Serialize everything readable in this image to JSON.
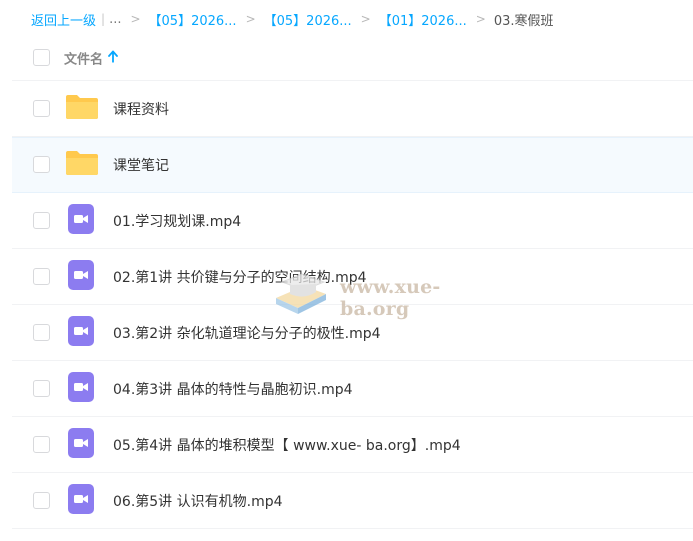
{
  "breadcrumb": {
    "back_label": "返回上一级",
    "pipe": "|",
    "ellipsis": "...",
    "separator": ">",
    "links": [
      "【05】2026...",
      "【05】2026...",
      "【01】2026..."
    ],
    "current": "03.寒假班"
  },
  "header": {
    "column_label": "文件名",
    "sort": "ascending"
  },
  "files": [
    {
      "name": "课程资料",
      "type": "folder"
    },
    {
      "name": "课堂笔记",
      "type": "folder"
    },
    {
      "name": "01.学习规划课.mp4",
      "type": "video"
    },
    {
      "name": "02.第1讲 共价键与分子的空间结构.mp4",
      "type": "video"
    },
    {
      "name": "03.第2讲 杂化轨道理论与分子的极性.mp4",
      "type": "video"
    },
    {
      "name": "04.第3讲 晶体的特性与晶胞初识.mp4",
      "type": "video"
    },
    {
      "name": "05.第4讲 晶体的堆积模型【 www.xue- ba.org】.mp4",
      "type": "video"
    },
    {
      "name": "06.第5讲 认识有机物.mp4",
      "type": "video"
    }
  ],
  "watermark": {
    "text": "www.xue-ba.org"
  },
  "colors": {
    "link": "#06a7ff",
    "folder": "#ffc94d",
    "video": "#8c7cf0",
    "highlight_row": "#f5fafe"
  }
}
